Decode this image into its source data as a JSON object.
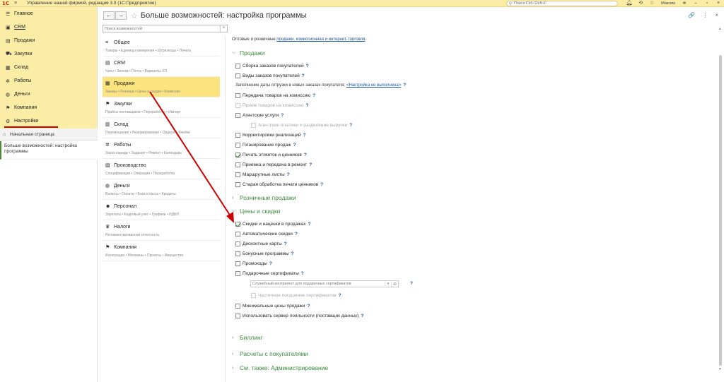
{
  "titlebar": {
    "logo": "1С",
    "title": "Управление нашей фирмой, редакция 3.0  (1С:Предприятие)",
    "search_placeholder": "Поиск Ctrl+Shift+F",
    "user": "Максим"
  },
  "leftnav": {
    "items": [
      {
        "label": "Главное",
        "icon": "menu-icon"
      },
      {
        "label": "CRM",
        "icon": "crm-icon"
      },
      {
        "label": "Продажи",
        "icon": "sales-icon"
      },
      {
        "label": "Закупки",
        "icon": "purchases-icon"
      },
      {
        "label": "Склад",
        "icon": "warehouse-icon"
      },
      {
        "label": "Работы",
        "icon": "works-icon"
      },
      {
        "label": "Деньги",
        "icon": "money-icon"
      },
      {
        "label": "Компания",
        "icon": "flag-icon"
      },
      {
        "label": "Настройки",
        "icon": "gear-icon"
      }
    ],
    "home": "Начальная страница",
    "current_page": "Больше возможностей: настройка программы"
  },
  "header": {
    "back": "←",
    "forward": "→",
    "title": "Больше возможностей: настройка программы",
    "link_icon": "🔗",
    "more_icon": "⋮",
    "close_icon": "×"
  },
  "sections_search": {
    "placeholder": "Поиск возможностей",
    "clear": "×"
  },
  "sections": [
    {
      "title": "Общее",
      "desc": "Товары • Единицы измерения • Штрихкоды • Печать",
      "icon": "≡"
    },
    {
      "title": "CRM",
      "desc": "Чаты • Звонки • Почта • Варианты ХП",
      "icon": "▤"
    },
    {
      "title": "Продажи",
      "desc": "Заказы • Розница • Цены и скидки • Комиссия",
      "icon": "▦"
    },
    {
      "title": "Закупки",
      "desc": "Прайсы поставщиков • Переработка • Импорт",
      "icon": "⚑"
    },
    {
      "title": "Склад",
      "desc": "Перемещения • Резервирование • Ордера • Ячейки",
      "icon": "▥"
    },
    {
      "title": "Работы",
      "desc": "Заказ-наряды • Задания • Ремонт • Календарь",
      "icon": "✲"
    },
    {
      "title": "Производство",
      "desc": "Спецификации • Операции • Переработка",
      "icon": "▧"
    },
    {
      "title": "Деньги",
      "desc": "Валюты • Оплаты • Банк и касса • Кредиты",
      "icon": "◍"
    },
    {
      "title": "Персонал",
      "desc": "Зарплата • Кадровый учет • Графики • НДФЛ",
      "icon": "☻"
    },
    {
      "title": "Налоги",
      "desc": "Регламентированная отчетность",
      "icon": "♛"
    },
    {
      "title": "Компания",
      "desc": "Интеграция • Магазины • Проекты • Имущество",
      "icon": "⚑"
    }
  ],
  "content": {
    "intro_text": "Оптовые и розничные",
    "intro_link": "продажи, комиссионная и интернет-торговля",
    "intro_end": ".",
    "group_sales": "Продажи",
    "sales_options": [
      {
        "label": "Сборка заказов покупателей",
        "checked": false,
        "disabled": false
      },
      {
        "label": "Виды заказов покупателей",
        "checked": false,
        "disabled": false
      }
    ],
    "shipment_fill_label": "Заполнение даты отгрузки в новых заказах покупателя:",
    "shipment_fill_link": "<Настройка не выполнена>",
    "sales_options2": [
      {
        "label": "Передача товаров на комиссию",
        "checked": false,
        "disabled": false
      },
      {
        "label": "Прием товаров на комиссию",
        "checked": false,
        "disabled": true
      },
      {
        "label": "Агентские услуги",
        "checked": false,
        "disabled": false
      }
    ],
    "agent_payments": "Агентские платежи и разделение выручки",
    "sales_options3": [
      {
        "label": "Корректировки реализаций",
        "checked": false,
        "disabled": false
      },
      {
        "label": "Планирование продаж",
        "checked": false,
        "disabled": false
      },
      {
        "label": "Печать этикеток и ценников",
        "checked": true,
        "disabled": false
      },
      {
        "label": "Приемка и передача в ремонт",
        "checked": false,
        "disabled": false
      },
      {
        "label": "Маршрутные листы",
        "checked": false,
        "disabled": false
      },
      {
        "label": "Старая обработка печати ценников",
        "checked": false,
        "disabled": false
      }
    ],
    "group_retail": "Розничные продажи",
    "group_prices": "Цены и скидки",
    "prices_options": [
      {
        "label": "Скидки и наценки в продажах",
        "checked": true,
        "disabled": false
      },
      {
        "label": "Автоматические скидки",
        "checked": false,
        "disabled": false
      },
      {
        "label": "Дисконтные карты",
        "checked": false,
        "disabled": false
      },
      {
        "label": "Бонусные программы",
        "checked": false,
        "disabled": false
      },
      {
        "label": "Промокоды",
        "checked": false,
        "disabled": false
      },
      {
        "label": "Подарочные сертификаты",
        "checked": false,
        "disabled": false
      }
    ],
    "cert_placeholder": "Служебный контрагент для подарочных сертификатов",
    "partial_payment": "Частичное погашение сертификатов",
    "prices_options2": [
      {
        "label": "Минимальные цены продажи",
        "checked": false,
        "disabled": false
      },
      {
        "label": "Использовать сервер лояльности (поставщик данных)",
        "checked": false,
        "disabled": false
      }
    ],
    "group_billing": "Биллинг",
    "group_settlements": "Расчеты с покупателями",
    "group_see_also": "См. также: Администрирование",
    "help": "?"
  },
  "colors": {
    "accent_yellow": "#fbeda6",
    "active_section": "#fbe47e",
    "green": "#3a8a3a",
    "link": "#1a55a0",
    "annotation_red": "#cc0000"
  }
}
